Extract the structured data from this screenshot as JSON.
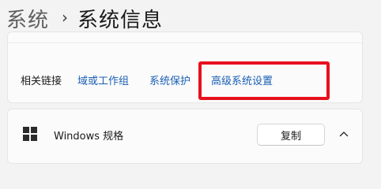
{
  "breadcrumb": {
    "parent": "系统",
    "separator": "›",
    "current": "系统信息"
  },
  "related_links": {
    "title": "相关链接",
    "links": [
      {
        "label": "域或工作组"
      },
      {
        "label": "系统保护"
      },
      {
        "label": "高级系统设置"
      }
    ]
  },
  "windows_spec": {
    "title": "Windows 规格",
    "copy_label": "复制",
    "expanded": true
  },
  "colors": {
    "link": "#1a5fb4",
    "highlight": "#e8101e",
    "background": "#f3f3f3",
    "card": "#fbfbfb"
  },
  "icons": [
    "windows-logo-icon",
    "chevron-up-icon"
  ]
}
